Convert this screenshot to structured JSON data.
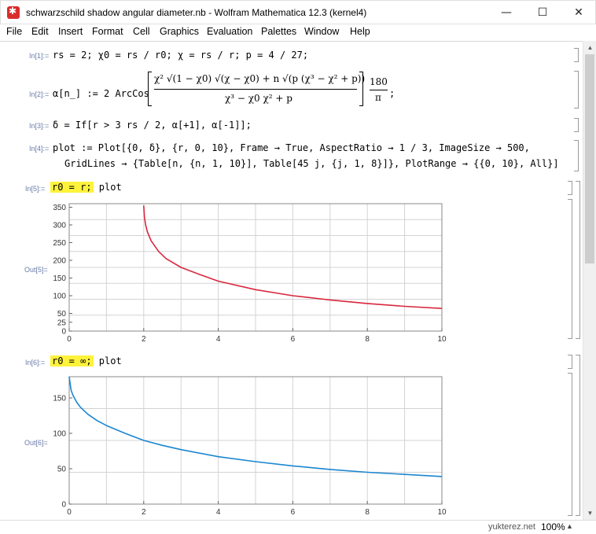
{
  "window": {
    "title": "schwarzschild shadow angular diameter.nb - Wolfram Mathematica 12.3 (kernel4)",
    "minimize": "—",
    "maximize": "☐",
    "close": "✕"
  },
  "menu": [
    "File",
    "Edit",
    "Insert",
    "Format",
    "Cell",
    "Graphics",
    "Evaluation",
    "Palettes",
    "Window",
    "Help"
  ],
  "cells": {
    "in1": {
      "label": "In[1]:=",
      "code": "rs = 2; χ0 = rs / r0; χ = rs / r; p = 4 / 27;"
    },
    "in2": {
      "label": "In[2]:=",
      "lhs": "α[n_] := 2 ArcCos",
      "numerator": "χ² √(1 − χ0) √(χ − χ0) + n √(p (χ³ − χ² + p))",
      "denominator": "χ³ − χ0 χ² + p",
      "factor_num": "180",
      "factor_den": "π",
      "tail": ";"
    },
    "in3": {
      "label": "In[3]:=",
      "code": "δ = If[r > 3 rs / 2, α[+1], α[-1]];"
    },
    "in4": {
      "label": "In[4]:=",
      "line1": "plot := Plot[{0, δ}, {r, 0, 10}, Frame → True, AspectRatio → 1 / 3, ImageSize → 500,",
      "line2": "GridLines → {Table[n, {n, 1, 10}], Table[45 j, {j, 1, 8}]}, PlotRange → {{0, 10}, All}]"
    },
    "in5": {
      "label": "In[5]:=",
      "highlight": "r0 = r;",
      "rest": " plot"
    },
    "out5": {
      "label": "Out[5]="
    },
    "in6": {
      "label": "In[6]:=",
      "highlight": "r0 = ∞;",
      "rest": " plot"
    },
    "out6": {
      "label": "Out[6]="
    }
  },
  "status": {
    "watermark": "yukterez.net",
    "zoom": "100%",
    "zoom_arrow": "▲"
  },
  "colors": {
    "plot1_curve": "#d9283e",
    "plot2_curve": "#1a86d1",
    "highlight": "#fff23b",
    "gridline": "#d3d3d3"
  },
  "chart_data": [
    {
      "type": "line",
      "title": "",
      "xlabel": "",
      "ylabel": "",
      "xlim": [
        0,
        10
      ],
      "ylim": [
        0,
        360
      ],
      "xticks": [
        0,
        2,
        4,
        6,
        8,
        10
      ],
      "yticks": [
        0,
        25,
        50,
        100,
        150,
        200,
        250,
        300,
        350
      ],
      "grid": true,
      "series": [
        {
          "x": [
            2.0,
            2.02,
            2.05,
            2.1,
            2.2,
            2.4,
            2.6,
            3.0,
            3.5,
            4.0,
            5.0,
            6.0,
            7.0,
            8.0,
            9.0,
            10.0
          ],
          "y": [
            355,
            322,
            300,
            280,
            255,
            225,
            205,
            180,
            160,
            141,
            117,
            100,
            88,
            78,
            70,
            64
          ]
        }
      ]
    },
    {
      "type": "line",
      "title": "",
      "xlabel": "",
      "ylabel": "",
      "xlim": [
        0,
        10
      ],
      "ylim": [
        0,
        180
      ],
      "xticks": [
        0,
        2,
        4,
        6,
        8,
        10
      ],
      "yticks": [
        0,
        50,
        100,
        150
      ],
      "grid": true,
      "series": [
        {
          "x": [
            0.0,
            0.05,
            0.1,
            0.2,
            0.3,
            0.5,
            0.75,
            1.0,
            1.5,
            2.0,
            2.5,
            3.0,
            4.0,
            5.0,
            6.0,
            7.0,
            8.0,
            9.0,
            10.0
          ],
          "y": [
            180,
            161,
            154,
            144,
            137,
            127,
            118,
            111,
            100,
            90,
            83,
            77,
            67,
            60,
            54,
            49,
            45,
            42,
            39
          ]
        }
      ]
    }
  ]
}
